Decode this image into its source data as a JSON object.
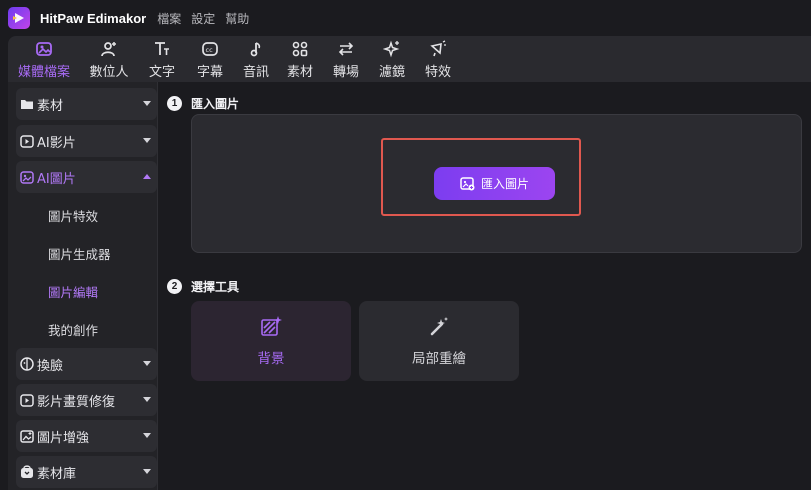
{
  "app": {
    "name": "HitPaw Edimakor",
    "menu": [
      "檔案",
      "設定",
      "幫助"
    ]
  },
  "toolbar": {
    "items": [
      {
        "label": "媒體檔案",
        "icon": "media-icon",
        "active": true
      },
      {
        "label": "數位人",
        "icon": "avatar-add-icon"
      },
      {
        "label": "文字",
        "icon": "text-icon"
      },
      {
        "label": "字幕",
        "icon": "subtitle-icon"
      },
      {
        "label": "音訊",
        "icon": "music-icon"
      },
      {
        "label": "素材",
        "icon": "assets-icon"
      },
      {
        "label": "轉場",
        "icon": "transition-icon"
      },
      {
        "label": "濾鏡",
        "icon": "filter-sparkle-icon"
      },
      {
        "label": "特效",
        "icon": "effects-icon"
      }
    ]
  },
  "sidebar": {
    "items": [
      {
        "label": "素材",
        "icon": "folder-icon"
      },
      {
        "label": "AI影片",
        "icon": "ai-video-icon"
      },
      {
        "label": "AI圖片",
        "icon": "ai-image-icon",
        "open": true
      },
      {
        "label": "換臉",
        "icon": "face-swap-icon"
      },
      {
        "label": "影片畫質修復",
        "icon": "video-repair-icon"
      },
      {
        "label": "圖片增強",
        "icon": "image-enhance-icon"
      },
      {
        "label": "素材庫",
        "icon": "library-icon"
      }
    ],
    "sub_items": [
      {
        "label": "圖片特效"
      },
      {
        "label": "圖片生成器"
      },
      {
        "label": "圖片編輯",
        "active": true
      },
      {
        "label": "我的創作"
      }
    ]
  },
  "main": {
    "step1": {
      "number": "1",
      "title": "匯入圖片",
      "button_label": "匯入圖片"
    },
    "step2": {
      "number": "2",
      "title": "選擇工具"
    },
    "tools": [
      {
        "label": "背景",
        "icon": "background-icon",
        "active": true
      },
      {
        "label": "局部重繪",
        "icon": "magic-wand-icon"
      }
    ]
  },
  "colors": {
    "accent": "#a86bf5",
    "button_gradient_start": "#7c3df0",
    "button_gradient_end": "#9c45f0",
    "highlight_border": "#e0584f"
  }
}
